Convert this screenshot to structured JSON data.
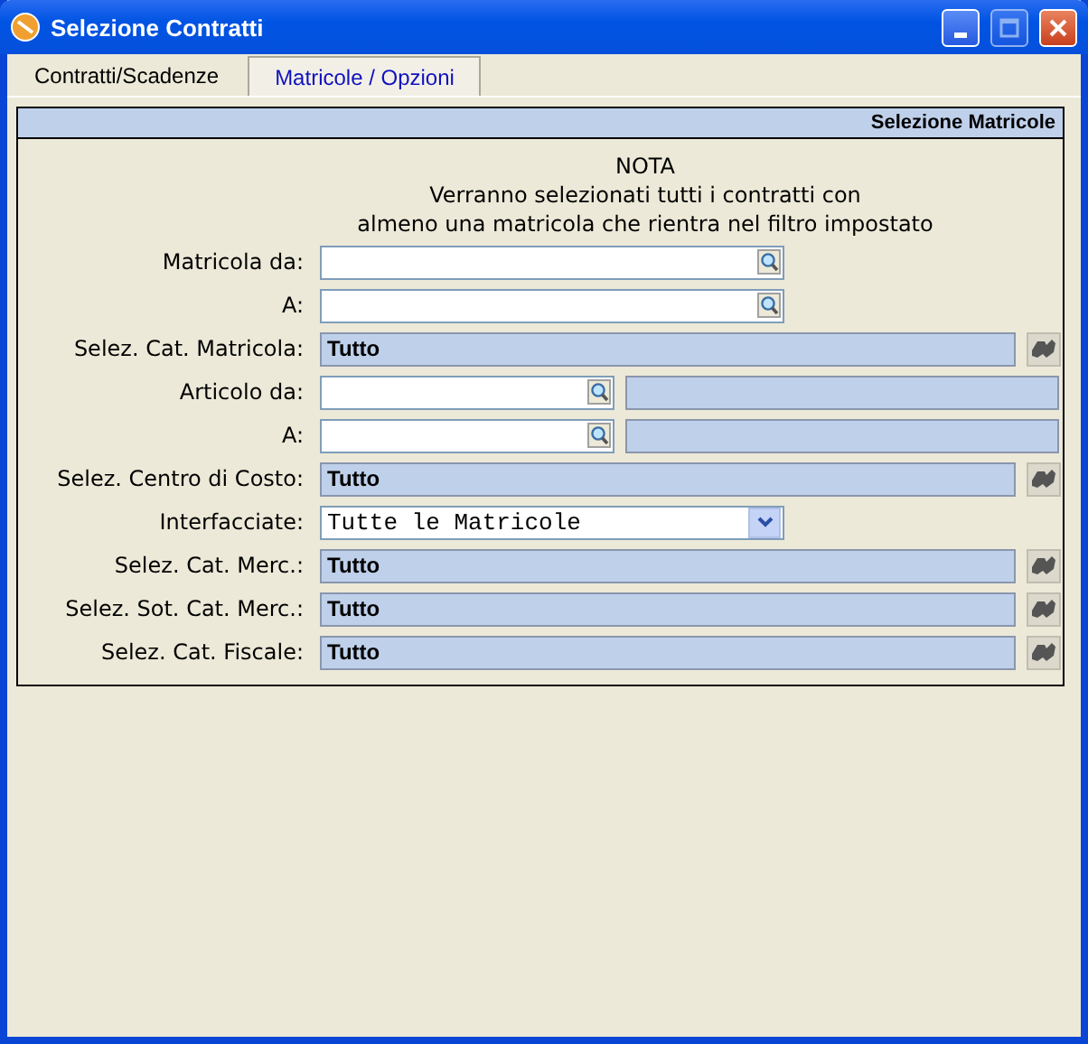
{
  "window": {
    "title": "Selezione Contratti"
  },
  "tabs": [
    {
      "label": "Contratti/Scadenze",
      "selected": false
    },
    {
      "label": "Matricole / Opzioni",
      "selected": true
    }
  ],
  "panel": {
    "title": "Selezione Matricole",
    "note": [
      "NOTA",
      "Verranno selezionati tutti i contratti con",
      "almeno una matricola che rientra nel filtro impostato"
    ]
  },
  "rows": [
    {
      "kind": "lookup",
      "label": "Matricola da:"
    },
    {
      "kind": "lookup",
      "label": "A:"
    },
    {
      "kind": "category",
      "label": "Selez. Cat. Matricola:",
      "value": "Tutto"
    },
    {
      "kind": "article",
      "label": "Articolo da:"
    },
    {
      "kind": "article",
      "label": "A:"
    },
    {
      "kind": "category",
      "label": "Selez. Centro di Costo:",
      "value": "Tutto"
    },
    {
      "kind": "dropdown",
      "label": "Interfacciate:",
      "value": "Tutte le Matricole"
    },
    {
      "kind": "category",
      "label": "Selez. Cat. Merc.:",
      "value": "Tutto"
    },
    {
      "kind": "category",
      "label": "Selez. Sot. Cat. Merc.:",
      "value": "Tutto"
    },
    {
      "kind": "category",
      "label": "Selez. Cat. Fiscale:",
      "value": "Tutto"
    }
  ]
}
